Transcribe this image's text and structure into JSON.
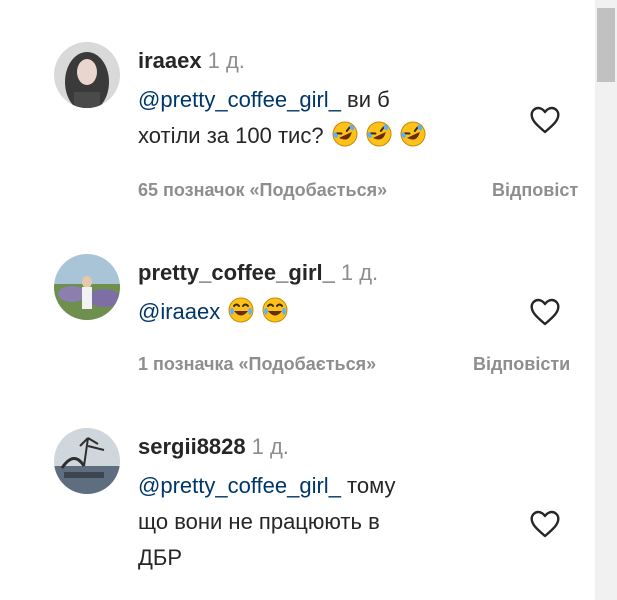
{
  "comments": [
    {
      "username": "iraaex",
      "time": "1 д.",
      "mention": "@pretty_coffee_girl_",
      "text_line1": " ви б",
      "text_line2": "хотіли за 100 тис?",
      "emoji": "rolling-on-floor-laughing-emoji",
      "emoji_count": 3,
      "likes_label": "65 позначок «Подобається»",
      "reply_label": "Відповіст"
    },
    {
      "username": "pretty_coffee_girl_",
      "time": "1 д.",
      "mention": "@iraaex",
      "emoji": "face-with-tears-of-joy-emoji",
      "emoji_count": 2,
      "likes_label": "1 позначка «Подобається»",
      "reply_label": "Відповісти"
    },
    {
      "username": "sergii8828",
      "time": "1 д.",
      "mention": "@pretty_coffee_girl_",
      "text_line1": " тому",
      "text_line2": "що вони не працюють в",
      "text_line3": "ДБР"
    }
  ],
  "icons": {
    "like": "heart-outline-icon"
  },
  "colors": {
    "username": "#262626",
    "mention": "#00376b",
    "muted": "#8e8e8e"
  }
}
